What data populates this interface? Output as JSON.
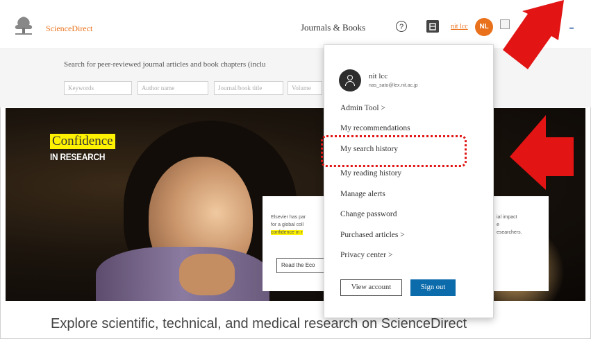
{
  "header": {
    "brand": "ScienceDirect",
    "journals_books": "Journals & Books",
    "help_symbol": "⑦",
    "user_link": "nit lcc",
    "avatar_initials": "NL",
    "edge_link": "..."
  },
  "search": {
    "prompt": "Search for peer-reviewed journal articles and book chapters (inclu",
    "fields": [
      "Keywords",
      "Author name",
      "Journal/book title",
      "Volume"
    ]
  },
  "hero": {
    "title": "Confidence",
    "subtitle": "IN RESEARCH",
    "promo_left": [
      "Elsevier has par",
      "for a global coll",
      "confidence in r"
    ],
    "promo_right": [
      "ial impact",
      "e",
      "esearchers."
    ],
    "promo_button": "Read the Eco"
  },
  "explore": "Explore scientific, technical, and medical research on ScienceDirect",
  "dropdown": {
    "user_name": "nit lcc",
    "email": "nas_sato@lex.nit.ac.jp",
    "items": [
      "Admin Tool >",
      "My recommendations",
      "My search history",
      "My reading history",
      "Manage alerts",
      "Change password",
      "Purchased articles >",
      "Privacy center >"
    ],
    "view_account": "View account",
    "sign_out": "Sign out"
  },
  "colors": {
    "brand_orange": "#e9711c",
    "signout_blue": "#0c6bab",
    "highlight_yellow": "#fff200",
    "annotation_red": "#e21414"
  }
}
